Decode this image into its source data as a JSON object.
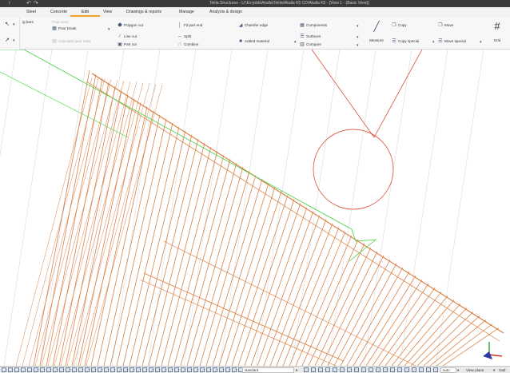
{
  "window": {
    "title": "Tekla Structures - U:\\Ex-jobb\\Akalla\\Tekla\\Akalla K5 CD\\Akalla K5 - [View 1 - (Basic View)]",
    "quick_access": [
      "↑",
      "↶",
      "↷"
    ]
  },
  "menu": {
    "tabs": [
      {
        "label": "Steel"
      },
      {
        "label": "Concrete"
      },
      {
        "label": "Edit",
        "active": true
      },
      {
        "label": "View"
      },
      {
        "label": "Drawings & reports"
      },
      {
        "label": "Manage"
      },
      {
        "label": "Analysis & design"
      }
    ]
  },
  "ribbon": {
    "left_group": {
      "rebars_label": "ig bars",
      "pour_view_label": "Pour view",
      "pour_break_label": "Pour break",
      "calculate_label": "Calculate pour units"
    },
    "cut_group": {
      "polygon_cut": "Polygon cut",
      "line_cut": "Line cut",
      "part_cut": "Part cut",
      "fit_part_end": "Fit part end",
      "split": "Split",
      "combine": "Combine"
    },
    "edge_group": {
      "chamfer_edge": "Chamfer edge",
      "added_material": "Added material"
    },
    "components_group": {
      "components": "Components",
      "surfaces": "Surfaces",
      "compare": "Compare"
    },
    "measure_label": "Measure",
    "copy_group": {
      "copy": "Copy",
      "copy_special": "Copy special",
      "move": "Move",
      "move_special": "Move special"
    },
    "grid_label": "Grid"
  },
  "statusbar": {
    "phase_value": "standard",
    "auto_label": "auto",
    "view_plane_label": "View plane",
    "outline_label": "Outl"
  },
  "colors": {
    "accent": "#f2a22a",
    "rebar": "#d97a3a",
    "grid_green": "#3fd13f",
    "construction_red": "#d43a1f"
  }
}
